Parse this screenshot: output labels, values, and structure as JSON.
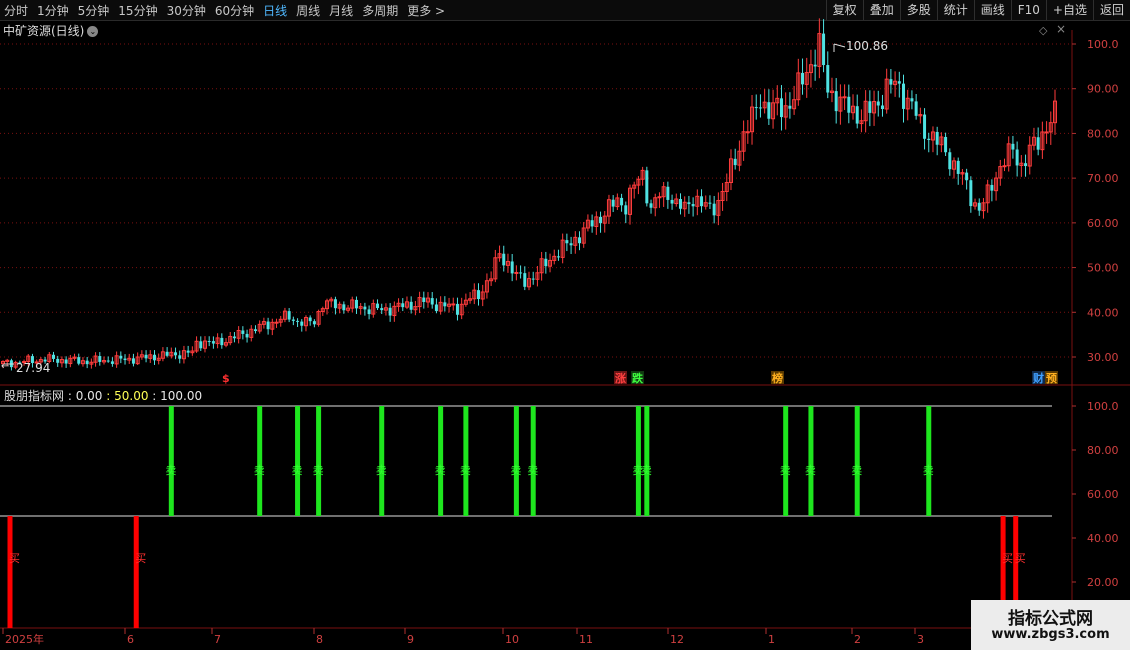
{
  "toolbar": {
    "periods": [
      "分时",
      "1分钟",
      "5分钟",
      "15分钟",
      "30分钟",
      "60分钟",
      "日线",
      "周线",
      "月线",
      "多周期",
      "更多 >"
    ],
    "active_index": 6,
    "actions": [
      "复权",
      "叠加",
      "多股",
      "统计",
      "画线",
      "F10",
      "+自选",
      "返回"
    ]
  },
  "title": {
    "name": "中矿资源(日线)",
    "icon": "chevron-down-icon",
    "extra_icons": [
      "diamond-icon",
      "close-icon"
    ]
  },
  "indicator": {
    "name": "股朋指标网",
    "values": [
      ": 0.00",
      ": 50.00",
      ": 100.00"
    ]
  },
  "watermark": {
    "line1": "指标公式网",
    "line2": "www.zbgs3.com"
  },
  "colors": {
    "up": "#ff3c3c",
    "down": "#4fe2e2",
    "buy": "#ff0000",
    "sell": "#1ee61e",
    "grid": "#7a1010",
    "text": "#c8c8c8"
  },
  "chart_data": [
    {
      "type": "candlestick",
      "title": "中矿资源(日线)",
      "y_ticks": [
        "100.0",
        "90.00",
        "80.00",
        "70.00",
        "60.00",
        "50.00",
        "40.00",
        "30.00"
      ],
      "ylim": [
        25,
        105
      ],
      "grid": true,
      "x_ticks": [
        "2025年",
        "6",
        "7",
        "8",
        "9",
        "10",
        "11",
        "12",
        "1",
        "2",
        "3"
      ],
      "annotations": [
        {
          "text": "100.86",
          "type": "high"
        },
        {
          "text": "27.94",
          "type": "low"
        },
        {
          "text": "$",
          "type": "event"
        },
        {
          "text": "涨",
          "type": "event"
        },
        {
          "text": "跌",
          "type": "event"
        },
        {
          "text": "榜",
          "type": "event"
        },
        {
          "text": "财",
          "type": "event"
        },
        {
          "text": "预",
          "type": "event"
        }
      ],
      "close_trend": [
        [
          0,
          28.5
        ],
        [
          10,
          29.5
        ],
        [
          20,
          29.0
        ],
        [
          30,
          29.5
        ],
        [
          40,
          30.5
        ],
        [
          45,
          31.0
        ],
        [
          46,
          33.0
        ],
        [
          48,
          33.5
        ],
        [
          50,
          33.0
        ],
        [
          52,
          33.5
        ],
        [
          58,
          35.5
        ],
        [
          62,
          37
        ],
        [
          66,
          38.5
        ],
        [
          68,
          39
        ],
        [
          70,
          38
        ],
        [
          72,
          37.5
        ],
        [
          74,
          38
        ],
        [
          76,
          42
        ],
        [
          80,
          41.5
        ],
        [
          86,
          41
        ],
        [
          90,
          40.5
        ],
        [
          96,
          41.5
        ],
        [
          100,
          42.5
        ],
        [
          104,
          41.5
        ],
        [
          108,
          41
        ],
        [
          110,
          42.5
        ],
        [
          113,
          44
        ],
        [
          116,
          48
        ],
        [
          118,
          53
        ],
        [
          120,
          51
        ],
        [
          122,
          48
        ],
        [
          124,
          47
        ],
        [
          126,
          48
        ],
        [
          130,
          52
        ],
        [
          134,
          55
        ],
        [
          138,
          58
        ],
        [
          140,
          60
        ],
        [
          144,
          63
        ],
        [
          146,
          65
        ],
        [
          148,
          64
        ],
        [
          150,
          68
        ],
        [
          152,
          71
        ],
        [
          154,
          63
        ],
        [
          156,
          66
        ],
        [
          158,
          67
        ],
        [
          160,
          64
        ],
        [
          162,
          63
        ],
        [
          164,
          66
        ],
        [
          166,
          64
        ],
        [
          168,
          63
        ],
        [
          170,
          65
        ],
        [
          172,
          69
        ],
        [
          176,
          80
        ],
        [
          178,
          83
        ],
        [
          180,
          88
        ],
        [
          182,
          85
        ],
        [
          186,
          86
        ],
        [
          188,
          88
        ],
        [
          192,
          96
        ],
        [
          194,
          99
        ],
        [
          196,
          90
        ],
        [
          198,
          88
        ],
        [
          200,
          86
        ],
        [
          204,
          84
        ],
        [
          206,
          85
        ],
        [
          208,
          87
        ],
        [
          210,
          90
        ],
        [
          212,
          91
        ],
        [
          214,
          89
        ],
        [
          216,
          86
        ],
        [
          218,
          82
        ],
        [
          220,
          80
        ],
        [
          222,
          78
        ],
        [
          224,
          76
        ],
        [
          226,
          73
        ],
        [
          228,
          70
        ],
        [
          230,
          66
        ],
        [
          232,
          63
        ],
        [
          234,
          66
        ],
        [
          236,
          71
        ],
        [
          238,
          74
        ],
        [
          240,
          76
        ],
        [
          242,
          73
        ],
        [
          244,
          76
        ],
        [
          246,
          78
        ],
        [
          248,
          82
        ],
        [
          250,
          84
        ]
      ]
    },
    {
      "type": "bar",
      "title": "股朋指标网",
      "y_ticks": [
        "100.0",
        "80.00",
        "60.00",
        "40.00",
        "20.00"
      ],
      "ylim": [
        0,
        110
      ],
      "reference_lines": [
        100,
        50
      ],
      "buy_label": "买",
      "sell_label": "卖",
      "buy_signals": [
        0,
        30,
        236,
        239
      ],
      "sell_signals": [
        40,
        61,
        70,
        75,
        90,
        104,
        110,
        122,
        126,
        151,
        153,
        186,
        192,
        203,
        220
      ]
    }
  ]
}
